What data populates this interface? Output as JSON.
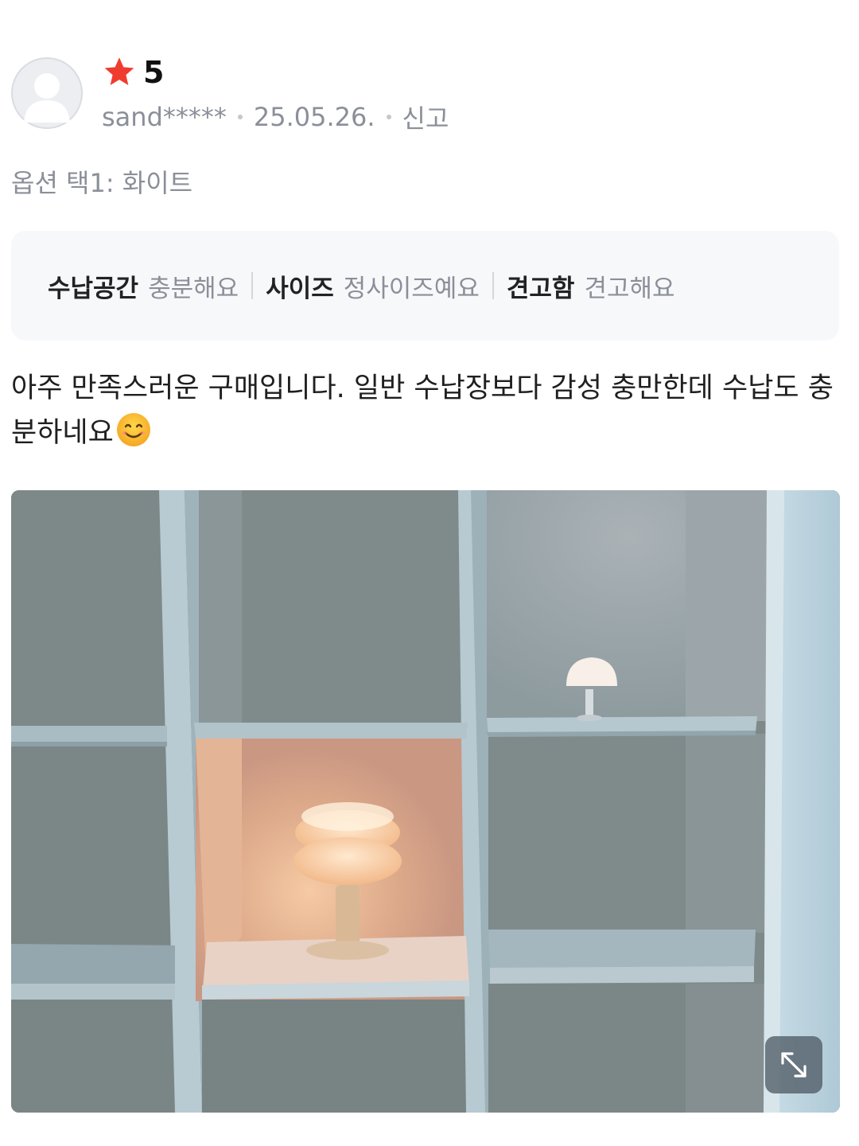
{
  "review": {
    "rating": "5",
    "author": "sand*****",
    "date": "25.05.26.",
    "report_label": "신고",
    "option_text": "옵션 택1: 화이트",
    "attributes": [
      {
        "key": "수납공간",
        "value": "충분해요"
      },
      {
        "key": "사이즈",
        "value": "정사이즈예요"
      },
      {
        "key": "견고함",
        "value": "견고해요"
      }
    ],
    "body_text": "아주 만족스러운 구매입니다. 일반 수납장보다 감성 충만한데 수납도 충분하네요",
    "emoji": "smiling-face-icon"
  },
  "icons": {
    "star": "star-icon",
    "avatar": "user-avatar-icon",
    "expand": "expand-icon"
  },
  "colors": {
    "star": "#f03c2e",
    "muted_text": "#8b8f99",
    "attr_box_bg": "#f7f8fa"
  }
}
